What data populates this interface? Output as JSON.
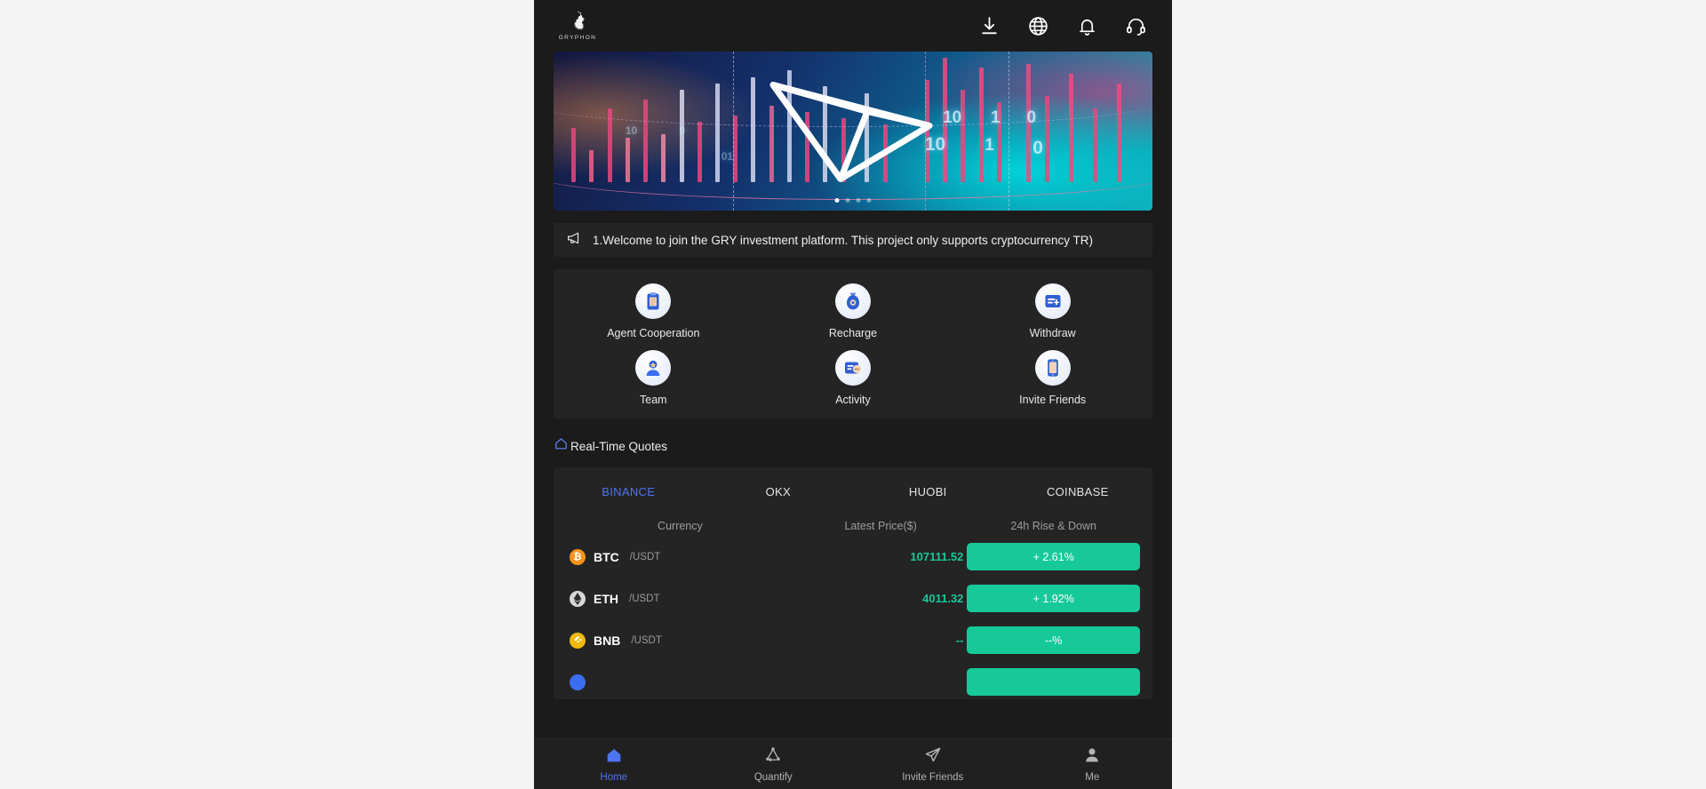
{
  "theme": {
    "page_bg": "#f4f4f4",
    "app_bg": "#1b1b1b",
    "card_bg": "#242424",
    "accent_blue": "#4f74f0",
    "up_green": "#17c999",
    "down_red": "#e8534f",
    "muted_text": "#9d9d9d"
  },
  "header": {
    "brand": "GRYPHON",
    "logo_icon": "gryphon-logo-icon",
    "icons": [
      {
        "name": "download-icon",
        "label": "Download"
      },
      {
        "name": "globe-icon",
        "label": "Language"
      },
      {
        "name": "bell-icon",
        "label": "Notifications"
      },
      {
        "name": "headset-icon",
        "label": "Customer Service"
      }
    ]
  },
  "banner": {
    "alt": "TRON crypto trading banner",
    "slide_count": 4,
    "active_slide": 1,
    "overlay_digits": [
      "10",
      "1",
      "0",
      "10",
      "1",
      "0",
      "0",
      "1"
    ]
  },
  "announcement": {
    "icon": "megaphone-icon",
    "text": "1.Welcome to join the GRY investment platform. This project only supports cryptocurrency TR)"
  },
  "quick_actions": [
    {
      "label": "Agent Cooperation",
      "icon": "clipboard-icon"
    },
    {
      "label": "Recharge",
      "icon": "money-bag-icon"
    },
    {
      "label": "Withdraw",
      "icon": "withdraw-card-icon"
    },
    {
      "label": "Team",
      "icon": "team-person-icon"
    },
    {
      "label": "Activity",
      "icon": "activity-chat-icon"
    },
    {
      "label": "Invite Friends",
      "icon": "invite-phone-icon"
    }
  ],
  "quotes": {
    "section_icon": "home-icon",
    "section_title": "Real-Time Quotes",
    "exchanges": [
      {
        "label": "BINANCE",
        "active": true
      },
      {
        "label": "OKX",
        "active": false
      },
      {
        "label": "HUOBI",
        "active": false
      },
      {
        "label": "COINBASE",
        "active": false
      }
    ],
    "columns": [
      "Currency",
      "Latest Price($)",
      "24h Rise & Down"
    ],
    "rows": [
      {
        "symbol": "BTC",
        "pair": "/USDT",
        "price": "107111.52",
        "change": "+ 2.61%",
        "direction": "up",
        "coin_color": "#f7931a"
      },
      {
        "symbol": "ETH",
        "pair": "/USDT",
        "price": "4011.32",
        "change": "+ 1.92%",
        "direction": "up",
        "coin_color": "#d8d8d8"
      },
      {
        "symbol": "BNB",
        "pair": "/USDT",
        "price": "--",
        "change": "--%",
        "direction": "up",
        "coin_color": "#f0b90b"
      },
      {
        "symbol": "",
        "pair": "",
        "price": "",
        "change": "",
        "direction": "up",
        "coin_color": "#3b6ef0"
      }
    ]
  },
  "floating_service": {
    "name": "customer-service-avatar",
    "alt": "Customer service agent with headset"
  },
  "tabbar": [
    {
      "label": "Home",
      "icon": "home-icon",
      "active": true
    },
    {
      "label": "Quantify",
      "icon": "network-nodes-icon",
      "active": false
    },
    {
      "label": "Invite Friends",
      "icon": "paper-plane-icon",
      "active": false
    },
    {
      "label": "Me",
      "icon": "person-icon",
      "active": false
    }
  ]
}
